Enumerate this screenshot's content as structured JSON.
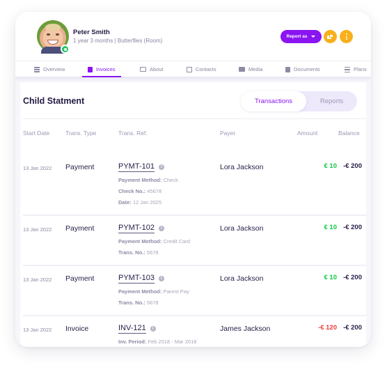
{
  "profile": {
    "name": "Peter Smith",
    "subtitle": "1 year 3 months | Butterflies (Room)",
    "status": "online"
  },
  "actions": {
    "report_label": "Report as",
    "chat_icon": "chat-bubbles-icon",
    "more_icon": "more-vertical-icon"
  },
  "tabs": [
    {
      "label": "Overview",
      "icon": "list-icon",
      "active": false
    },
    {
      "label": "Invoices",
      "icon": "invoice-icon",
      "active": true
    },
    {
      "label": "About",
      "icon": "id-card-icon",
      "active": false
    },
    {
      "label": "Contacts",
      "icon": "contacts-icon",
      "active": false
    },
    {
      "label": "Media",
      "icon": "image-icon",
      "active": false
    },
    {
      "label": "Documents",
      "icon": "document-icon",
      "active": false
    },
    {
      "label": "Plans",
      "icon": "sliders-icon",
      "active": false
    }
  ],
  "statement": {
    "title": "Child Statment",
    "segments": [
      "Transactions",
      "Reports"
    ],
    "active_segment": "Transactions",
    "columns": [
      "Start Date",
      "Trans. Type",
      "Trans. Ref.",
      "Payer",
      "Amount",
      "Balance"
    ],
    "rows": [
      {
        "date": "13 Jan 2022",
        "type": "Payment",
        "ref": "PYMT-101",
        "payer": "Lora Jackson",
        "amount": "€ 10",
        "amount_sign": "positive",
        "balance": "-€ 200",
        "details": [
          {
            "label": "Payment Method:",
            "value": "Check"
          },
          {
            "label": "Check No.:",
            "value": "45678"
          },
          {
            "label": "Date:",
            "value": "12 Jan 2025"
          }
        ]
      },
      {
        "date": "13 Jan 2022",
        "type": "Payment",
        "ref": "PYMT-102",
        "payer": "Lora Jackson",
        "amount": "€ 10",
        "amount_sign": "positive",
        "balance": "-€ 200",
        "details": [
          {
            "label": "Payment Method:",
            "value": "Credit Card"
          },
          {
            "label": "Trans. No.:",
            "value": "5678"
          }
        ]
      },
      {
        "date": "13 Jan 2022",
        "type": "Payment",
        "ref": "PYMT-103",
        "payer": "Lora Jackson",
        "amount": "€ 10",
        "amount_sign": "positive",
        "balance": "-€ 200",
        "details": [
          {
            "label": "Payment Method:",
            "value": "Parent Pay"
          },
          {
            "label": "Trans. No.:",
            "value": "5678"
          }
        ]
      },
      {
        "date": "13 Jan 2022",
        "type": "Invoice",
        "ref": "INV-121",
        "payer": "James Jackson",
        "amount": "-€ 120",
        "amount_sign": "negative",
        "balance": "-€ 200",
        "details": [
          {
            "label": "Inv. Period:",
            "value": "Feb 2018 - Mar 2018"
          }
        ]
      }
    ]
  },
  "colors": {
    "accent": "#8a15f0",
    "secondary": "#f8b11c",
    "positive": "#12c846",
    "negative": "#f03a3a",
    "text": "#241a45"
  }
}
